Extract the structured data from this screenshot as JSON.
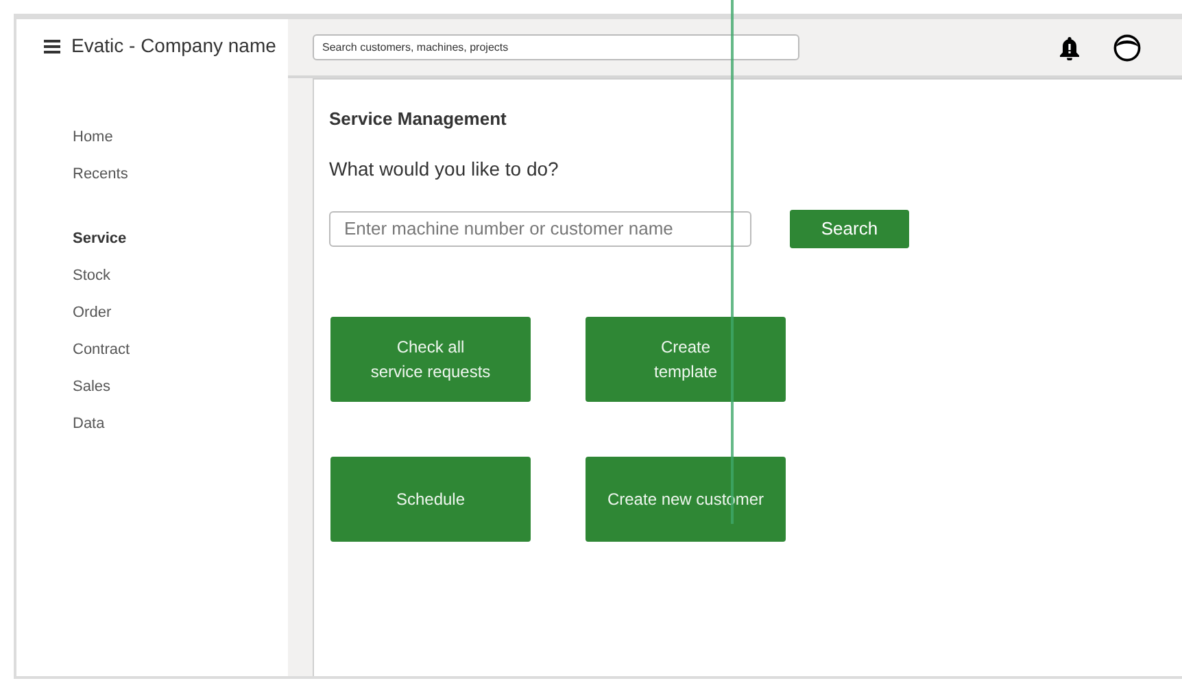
{
  "app_title": "Evatic - Company name",
  "global_search": {
    "placeholder": "Search customers, machines, projects"
  },
  "sidebar": {
    "groups": [
      [
        {
          "label": "Home",
          "selected": false
        },
        {
          "label": "Recents",
          "selected": false
        }
      ],
      [
        {
          "label": "Service",
          "selected": true
        },
        {
          "label": "Stock",
          "selected": false
        },
        {
          "label": "Order",
          "selected": false
        },
        {
          "label": "Contract",
          "selected": false
        },
        {
          "label": "Sales",
          "selected": false
        },
        {
          "label": "Data",
          "selected": false
        }
      ]
    ]
  },
  "main": {
    "title": "Service Management",
    "question": "What would you like to do?",
    "search": {
      "placeholder": "Enter machine number or customer name",
      "button": "Search"
    },
    "actions": [
      {
        "lines": [
          "Check all",
          "service requests"
        ]
      },
      {
        "lines": [
          "Create",
          "template"
        ]
      },
      {
        "lines": [
          "Schedule"
        ]
      },
      {
        "lines": [
          "Create new customer"
        ]
      }
    ]
  }
}
